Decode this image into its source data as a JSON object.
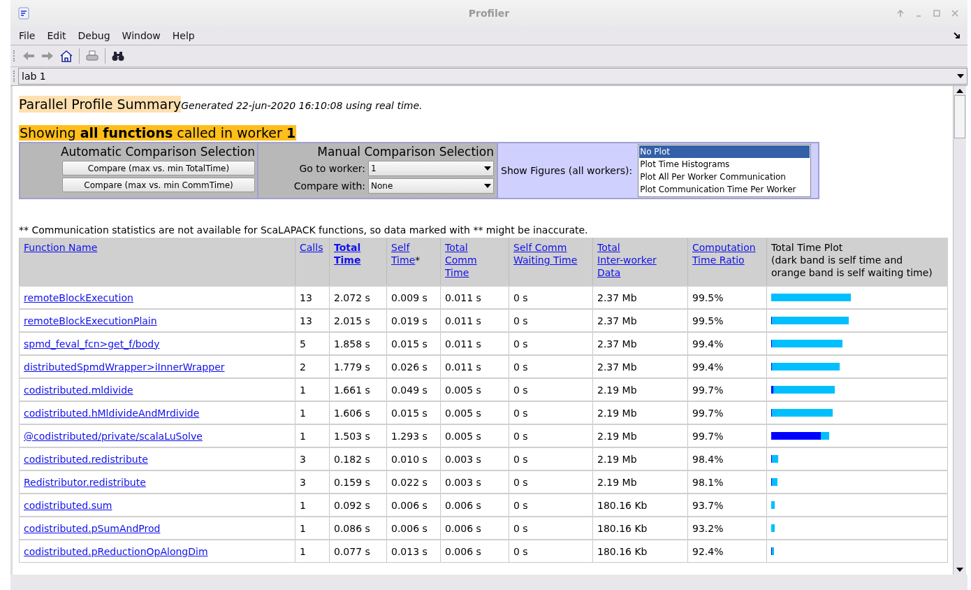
{
  "window": {
    "title": "Profiler"
  },
  "menu": [
    "File",
    "Edit",
    "Debug",
    "Window",
    "Help"
  ],
  "lab_select": {
    "value": "lab 1"
  },
  "summary": {
    "title": "Parallel Profile Summary",
    "generated": "Generated 22-jun-2020 16:10:08 using real time.",
    "showing": "Showing **all functions** called in worker **1**"
  },
  "automatic": {
    "title": "Automatic Comparison Selection",
    "buttons": [
      "Compare (max vs. min TotalTime)",
      "Compare (max vs. min CommTime)"
    ]
  },
  "manual": {
    "title": "Manual Comparison Selection",
    "go_to_label": "Go to worker:",
    "go_to_value": "1",
    "compare_label": "Compare with:",
    "compare_value": "None"
  },
  "figures": {
    "label": "Show Figures (all workers):",
    "options": [
      {
        "label": "No Plot",
        "selected": true
      },
      {
        "label": "Plot Time Histograms",
        "selected": false
      },
      {
        "label": "Plot All Per Worker Communication",
        "selected": false
      },
      {
        "label": "Plot Communication Time Per Worker",
        "selected": false
      }
    ]
  },
  "note": "** Communication statistics are not available for ScaLAPACK functions, so data marked with ** might be inaccurate.",
  "table": {
    "columns": [
      {
        "lines": [
          "Function Name"
        ],
        "link": true,
        "bold": false
      },
      {
        "lines": [
          "Calls"
        ],
        "link": true,
        "bold": false
      },
      {
        "lines": [
          "Total",
          "Time"
        ],
        "link": true,
        "bold": true
      },
      {
        "lines": [
          "Self",
          "Time"
        ],
        "link": true,
        "bold": false,
        "suffix": "*"
      },
      {
        "lines": [
          "Total",
          "Comm",
          "Time"
        ],
        "link": true,
        "bold": false
      },
      {
        "lines": [
          "Self Comm",
          "Waiting Time"
        ],
        "link": true,
        "bold": false
      },
      {
        "lines": [
          "Total",
          "Inter-worker",
          "Data"
        ],
        "link": true,
        "bold": false
      },
      {
        "lines": [
          "Computation",
          "Time Ratio"
        ],
        "link": true,
        "bold": false
      },
      {
        "lines": [
          "Total Time Plot",
          "(dark band is self time and",
          "orange band is self waiting time)"
        ],
        "link": false,
        "bold": false
      }
    ],
    "rows": [
      {
        "name": "remoteBlockExecution",
        "calls": "13",
        "total": "2.072 s",
        "self": "0.009 s",
        "comm": "0.011 s",
        "wait": "0 s",
        "data": "2.37 Mb",
        "ratio": "99.5%"
      },
      {
        "name": "remoteBlockExecutionPlain",
        "calls": "13",
        "total": "2.015 s",
        "self": "0.019 s",
        "comm": "0.011 s",
        "wait": "0 s",
        "data": "2.37 Mb",
        "ratio": "99.5%"
      },
      {
        "name": "spmd_feval_fcn>get_f/body",
        "calls": "5",
        "total": "1.858 s",
        "self": "0.015 s",
        "comm": "0.011 s",
        "wait": "0 s",
        "data": "2.37 Mb",
        "ratio": "99.4%"
      },
      {
        "name": "distributedSpmdWrapper>iInnerWrapper",
        "calls": "2",
        "total": "1.779 s",
        "self": "0.026 s",
        "comm": "0.011 s",
        "wait": "0 s",
        "data": "2.37 Mb",
        "ratio": "99.4%"
      },
      {
        "name": "codistributed.mldivide",
        "calls": "1",
        "total": "1.661 s",
        "self": "0.049 s",
        "comm": "0.005 s",
        "wait": "0 s",
        "data": "2.19 Mb",
        "ratio": "99.7%"
      },
      {
        "name": "codistributed.hMldivideAndMrdivide",
        "calls": "1",
        "total": "1.606 s",
        "self": "0.015 s",
        "comm": "0.005 s",
        "wait": "0 s",
        "data": "2.19 Mb",
        "ratio": "99.7%"
      },
      {
        "name": "@codistributed/private/scalaLuSolve",
        "calls": "1",
        "total": "1.503 s",
        "self": "1.293 s",
        "comm": "0.005 s",
        "wait": "0 s",
        "data": "2.19 Mb",
        "ratio": "99.7%"
      },
      {
        "name": "codistributed.redistribute",
        "calls": "3",
        "total": "0.182 s",
        "self": "0.010 s",
        "comm": "0.003 s",
        "wait": "0 s",
        "data": "2.19 Mb",
        "ratio": "98.4%"
      },
      {
        "name": "Redistributor.redistribute",
        "calls": "3",
        "total": "0.159 s",
        "self": "0.022 s",
        "comm": "0.003 s",
        "wait": "0 s",
        "data": "2.19 Mb",
        "ratio": "98.1%"
      },
      {
        "name": "codistributed.sum",
        "calls": "1",
        "total": "0.092 s",
        "self": "0.006 s",
        "comm": "0.006 s",
        "wait": "0 s",
        "data": "180.16 Kb",
        "ratio": "93.7%"
      },
      {
        "name": "codistributed.pSumAndProd",
        "calls": "1",
        "total": "0.086 s",
        "self": "0.006 s",
        "comm": "0.006 s",
        "wait": "0 s",
        "data": "180.16 Kb",
        "ratio": "93.2%"
      },
      {
        "name": "codistributed.pReductionOpAlongDim",
        "calls": "1",
        "total": "0.077 s",
        "self": "0.013 s",
        "comm": "0.006 s",
        "wait": "0 s",
        "data": "180.16 Kb",
        "ratio": "92.4%"
      }
    ]
  }
}
